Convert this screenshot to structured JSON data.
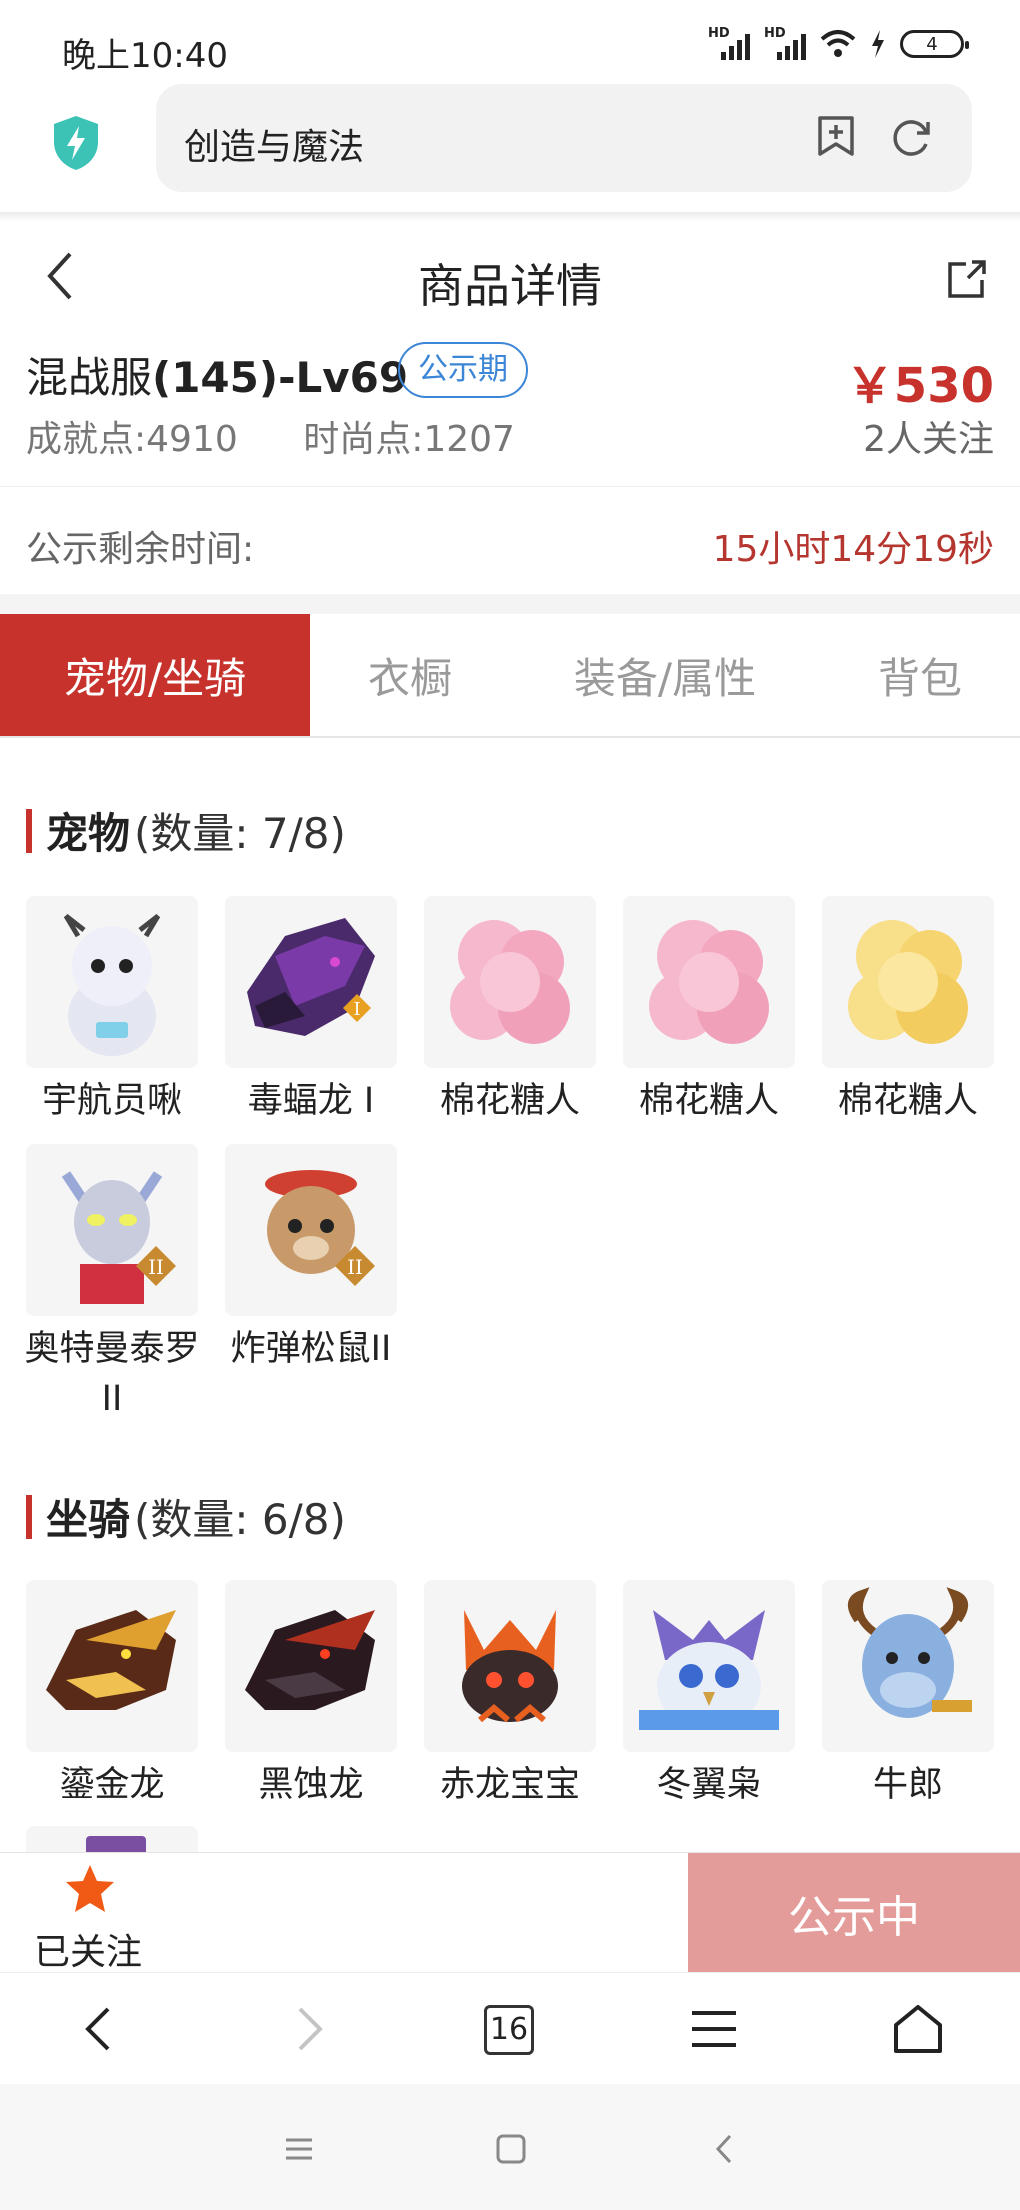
{
  "status_bar": {
    "time": "晚上10:40",
    "battery": "4",
    "signal_label": "HD"
  },
  "browser": {
    "title": "创造与魔法"
  },
  "header": {
    "title": "商品详情"
  },
  "product": {
    "server_prefix": "混战服",
    "server_level": "(145)-Lv69",
    "badge": "公示期",
    "price": "￥530",
    "achievement": "成就点:4910",
    "fashion": "时尚点:1207",
    "followers": "2人关注"
  },
  "countdown": {
    "label": "公示剩余时间:",
    "value": "15小时14分19秒"
  },
  "tabs": [
    {
      "label": "宠物/坐骑",
      "active": true
    },
    {
      "label": "衣橱",
      "active": false
    },
    {
      "label": "装备/属性",
      "active": false
    },
    {
      "label": "背包",
      "active": false
    }
  ],
  "pets": {
    "title": "宠物",
    "count": "(数量: 7/8)",
    "items": [
      {
        "name": "宇航员啾",
        "icon": "astronaut-pet-icon"
      },
      {
        "name": "毒蝠龙 I",
        "icon": "poison-bat-dragon-icon"
      },
      {
        "name": "棉花糖人",
        "icon": "marshmallow-pink-icon"
      },
      {
        "name": "棉花糖人",
        "icon": "marshmallow-pink-icon"
      },
      {
        "name": "棉花糖人",
        "icon": "marshmallow-yellow-icon"
      },
      {
        "name": "奥特曼泰罗II",
        "icon": "ultraman-icon"
      },
      {
        "name": "炸弹松鼠II",
        "icon": "bomb-squirrel-icon"
      }
    ]
  },
  "mounts": {
    "title": "坐骑",
    "count": "(数量: 6/8)",
    "items": [
      {
        "name": "鎏金龙",
        "icon": "gold-dragon-icon"
      },
      {
        "name": "黑蚀龙",
        "icon": "black-dragon-icon"
      },
      {
        "name": "赤龙宝宝",
        "icon": "red-baby-dragon-icon"
      },
      {
        "name": "冬翼枭",
        "icon": "winter-owl-icon"
      },
      {
        "name": "牛郎",
        "icon": "cowherd-icon"
      }
    ]
  },
  "action_bar": {
    "follow_label": "已关注",
    "status_label": "公示中"
  },
  "navbar": {
    "tab_count": "16"
  },
  "colors": {
    "accent": "#c8322c",
    "status_button": "#e49c9a",
    "badge_blue": "#3b86d6"
  }
}
